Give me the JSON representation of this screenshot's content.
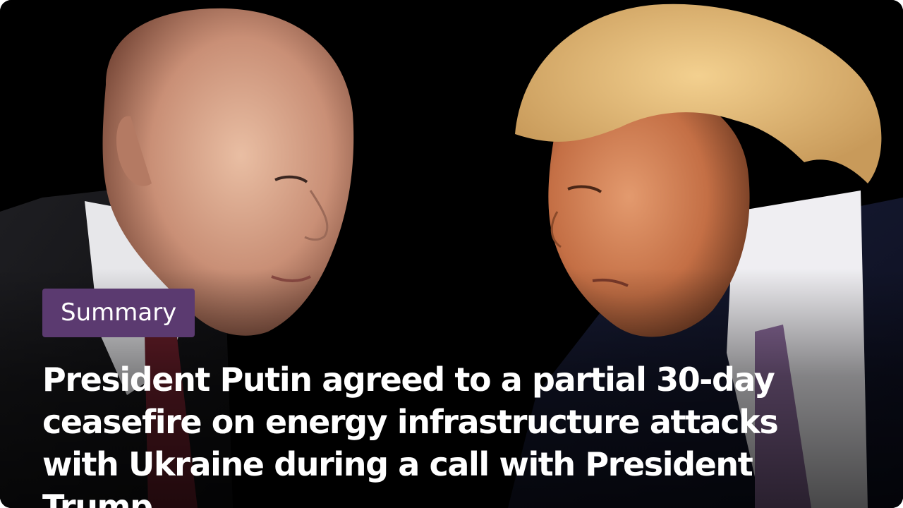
{
  "badge": {
    "label": "Summary",
    "color": "#5b3a70"
  },
  "headline": "President Putin agreed to a partial 30-day ceasefire on energy infrastructure attacks with Ukraine during a call with President Trump.",
  "photo": {
    "background": "#000000"
  }
}
